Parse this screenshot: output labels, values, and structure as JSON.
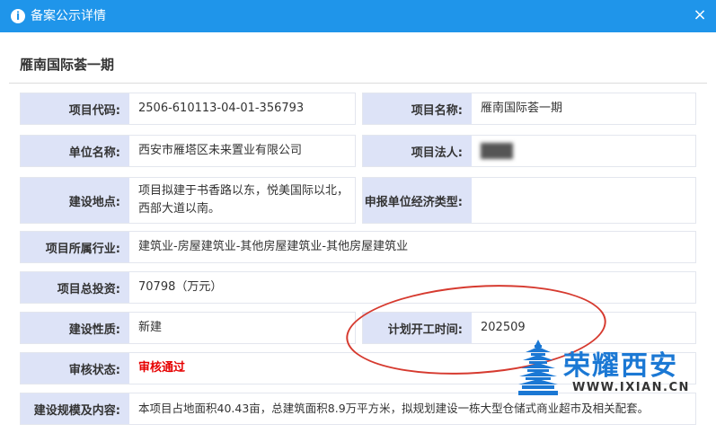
{
  "window": {
    "title": "备案公示详情",
    "close_symbol": "×"
  },
  "project_title": "雁南国际荟一期",
  "fields": {
    "project_code": {
      "label": "项目代码:",
      "value": "2506-610113-04-01-356793"
    },
    "project_name": {
      "label": "项目名称:",
      "value": "雁南国际荟一期"
    },
    "unit_name": {
      "label": "单位名称:",
      "value": "西安市雁塔区未来置业有限公司"
    },
    "legal_person": {
      "label": "项目法人:",
      "value": ""
    },
    "location": {
      "label": "建设地点:",
      "value": "项目拟建于书香路以东，悦美国际以北，西部大道以南。"
    },
    "economic_type": {
      "label": "申报单位经济类型:",
      "value": ""
    },
    "industry": {
      "label": "项目所属行业:",
      "value": "建筑业-房屋建筑业-其他房屋建筑业-其他房屋建筑业"
    },
    "total_investment": {
      "label": "项目总投资:",
      "value": "70798（万元）"
    },
    "nature": {
      "label": "建设性质:",
      "value": "新建"
    },
    "start_time": {
      "label": "计划开工时间:",
      "value": "202509"
    },
    "review_status": {
      "label": "审核状态:",
      "value": "审核通过"
    },
    "scale": {
      "label": "建设规模及内容:",
      "value": "本项目占地面积40.43亩，总建筑面积8.9万平方米，拟规划建设一栋大型仓储式商业超市及相关配套。"
    }
  },
  "watermark": {
    "brand": "荣耀西安",
    "url": "WWW.IXIAN.CN"
  },
  "colors": {
    "header": "#1f95ea",
    "label_bg": "#dde3f7",
    "status_red": "#e60000",
    "annotation": "#d63a2f",
    "brand_blue": "#1b78d4"
  }
}
